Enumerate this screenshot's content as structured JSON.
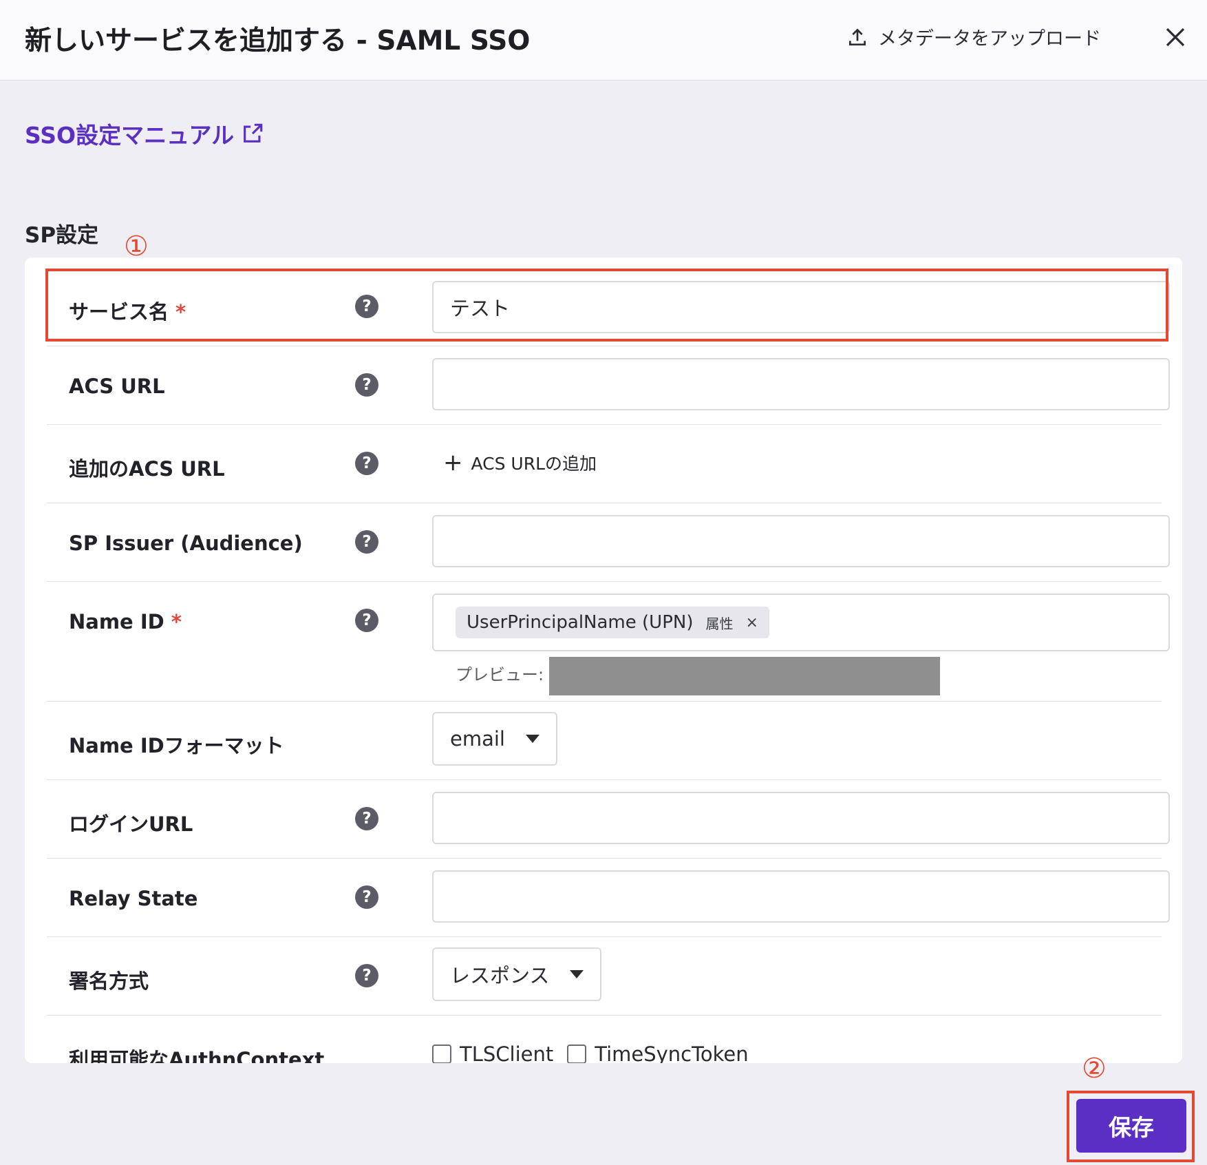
{
  "header": {
    "title": "新しいサービスを追加する - SAML SSO",
    "upload_label": "メタデータをアップロード",
    "upload_icon": "upload-icon",
    "close_icon": "close-icon"
  },
  "manual_link": {
    "label": "SSO設定マニュアル",
    "icon": "external-link-icon"
  },
  "section_title": "SP設定",
  "annotations": {
    "marker1": "①",
    "marker2": "②",
    "highlight_color": "#e24a33"
  },
  "form": {
    "service_name": {
      "label": "サービス名",
      "required": "*",
      "value": "テスト"
    },
    "acs_url": {
      "label": "ACS URL",
      "value": ""
    },
    "additional_acs_url": {
      "label": "追加のACS URL",
      "add_label": "ACS URLの追加",
      "add_icon": "+"
    },
    "sp_issuer": {
      "label": "SP Issuer (Audience)",
      "value": ""
    },
    "name_id": {
      "label": "Name ID",
      "required": "*",
      "chip_text": "UserPrincipalName (UPN)",
      "chip_tag": "属性",
      "chip_remove": "×",
      "preview_label": "プレビュー:"
    },
    "name_id_format": {
      "label": "Name IDフォーマット",
      "value": "email"
    },
    "login_url": {
      "label": "ログインURL",
      "value": ""
    },
    "relay_state": {
      "label": "Relay State",
      "value": ""
    },
    "signing_method": {
      "label": "署名方式",
      "value": "レスポンス"
    },
    "authn_context": {
      "label": "利用可能なAuthnContext",
      "options": [
        "TLSClient",
        "TimeSyncToken"
      ]
    },
    "help_glyph": "?"
  },
  "save_button": {
    "label": "保存"
  },
  "colors": {
    "accent": "#5b2fc6",
    "link": "#5a2fc2",
    "required": "#e0473c"
  }
}
